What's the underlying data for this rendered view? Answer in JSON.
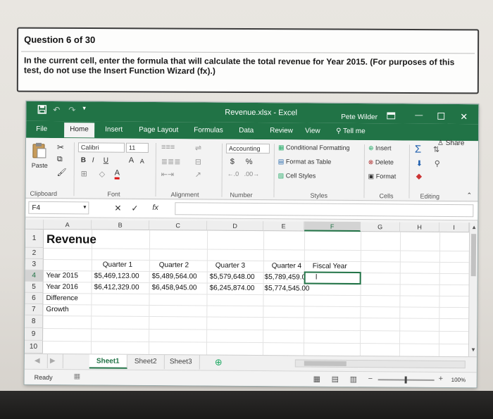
{
  "question": {
    "title": "Question 6 of 30",
    "body": "In the current cell, enter the formula that will calculate the total revenue for Year 2015. (For purposes of this test, do not use the Insert Function Wizard (fx).)"
  },
  "window": {
    "title": "Revenue.xlsx - Excel",
    "user": "Pete Wilder",
    "accent": "#217346"
  },
  "tabs": [
    "File",
    "Home",
    "Insert",
    "Page Layout",
    "Formulas",
    "Data",
    "Review",
    "View"
  ],
  "tell_me": "Tell me",
  "share": "Share",
  "ribbon": {
    "clipboard": {
      "paste": "Paste",
      "label": "Clipboard"
    },
    "font": {
      "name": "Calibri",
      "size": "11",
      "bold": "B",
      "italic": "I",
      "underline": "U",
      "grow": "A",
      "shrink": "A",
      "label": "Font"
    },
    "alignment": {
      "label": "Alignment"
    },
    "number": {
      "format": "Accounting",
      "currency": "$",
      "percent": "%",
      "label": "Number"
    },
    "styles": {
      "conditional": "Conditional Formatting",
      "table": "Format as Table",
      "cell_styles": "Cell Styles",
      "label": "Styles"
    },
    "cells": {
      "insert": "Insert",
      "delete": "Delete",
      "format": "Format",
      "label": "Cells"
    },
    "editing": {
      "sigma": "Σ",
      "label": "Editing"
    }
  },
  "formula_bar": {
    "name_box": "F4",
    "fx": "fx",
    "value": ""
  },
  "columns": [
    "A",
    "B",
    "C",
    "D",
    "E",
    "F",
    "G",
    "H",
    "I"
  ],
  "rows": [
    "1",
    "2",
    "3",
    "4",
    "5",
    "6",
    "7",
    "8",
    "9",
    "10"
  ],
  "cells": {
    "a1": "Revenue",
    "b3": "Quarter 1",
    "c3": "Quarter 2",
    "d3": "Quarter 3",
    "e3": "Quarter 4",
    "f3": "Fiscal Year",
    "a4": "Year 2015",
    "b4": "$5,469,123.00",
    "c4": "$5,489,564.00",
    "d4": "$5,579,648.00",
    "e4": "$5,789,459.00",
    "a5": "Year 2016",
    "b5": "$6,412,329.00",
    "c5": "$6,458,945.00",
    "d5": "$6,245,874.00",
    "e5": "$5,774,545.00",
    "a6": "Difference",
    "a7": "Growth"
  },
  "sheets": [
    "Sheet1",
    "Sheet2",
    "Sheet3"
  ],
  "status": {
    "ready": "Ready",
    "zoom": "100%"
  }
}
